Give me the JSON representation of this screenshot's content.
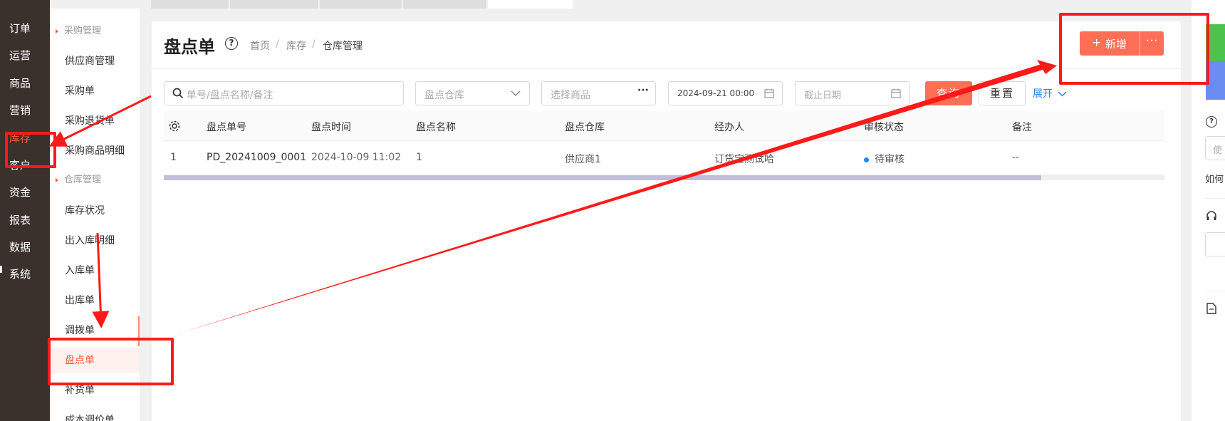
{
  "nav": [
    "订单",
    "运营",
    "商品",
    "营销",
    "库存",
    "客户",
    "资金",
    "报表",
    "数据",
    "系统"
  ],
  "nav_active": 4,
  "submenu": {
    "group1": "采购管理",
    "group1_items": [
      "供应商管理",
      "采购单",
      "采购退货单",
      "采购商品明细"
    ],
    "group2": "仓库管理",
    "group2_items": [
      "库存状况",
      "出入库明细",
      "入库单",
      "出库单",
      "调拨单",
      "盘点单",
      "补货单",
      "成本调价单"
    ],
    "active": "盘点单"
  },
  "header": {
    "title": "盘点单",
    "help": "?",
    "breadcrumb": [
      "首页",
      "库存",
      "仓库管理"
    ],
    "sep": "/",
    "add_plus": "+",
    "add_label": "新增",
    "more": "···"
  },
  "filters": {
    "search_placeholder": "单号/盘点名称/备注",
    "warehouse_placeholder": "盘点仓库",
    "product_placeholder": "选择商品",
    "product_more": "···",
    "start_date": "2024-09-21 00:00",
    "end_date_placeholder": "截止日期",
    "query": "查询",
    "reset": "重置",
    "expand": "展开"
  },
  "table": {
    "columns": [
      "盘点单号",
      "盘点时间",
      "盘点名称",
      "盘点仓库",
      "经办人",
      "审核状态",
      "备注"
    ],
    "rows": [
      {
        "index": "1",
        "no": "PD_20241009_0001",
        "time": "2024-10-09 11:02",
        "name": "1",
        "warehouse": "供应商1",
        "handler": "订货宝测试哈",
        "status": "待审核",
        "remark": "--"
      }
    ]
  },
  "right_panel": {
    "help": "?",
    "input_char": "使",
    "link": "如何"
  },
  "colors": {
    "accent": "#ff6f55",
    "nav_bg": "#3a302c",
    "link": "#2d7ef0",
    "annotation": "#ff1a1a",
    "status_dot": "#1e88ff"
  }
}
